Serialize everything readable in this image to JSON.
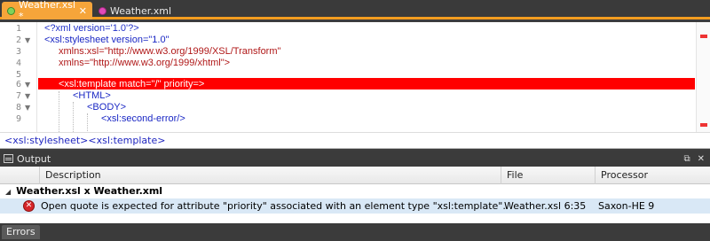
{
  "tabs": [
    {
      "label": "Weather.xsl *",
      "active": true
    },
    {
      "label": "Weather.xml",
      "active": false
    }
  ],
  "editor": {
    "line_numbers": [
      "1",
      "2",
      "3",
      "4",
      "5",
      "6",
      "7",
      "8",
      "9"
    ],
    "lines": {
      "l1": "<?xml version='1.0'?>",
      "l2": "<xsl:stylesheet version=\"1.0\"",
      "l3": "xmlns:xsl=\"http://www.w3.org/1999/XSL/Transform\"",
      "l4": "xmlns=\"http://www.w3.org/1999/xhtml\">",
      "l6": "<xsl:template match=\"/\" priority=>",
      "l7": "<HTML>",
      "l8": "<BODY>",
      "l9": "<xsl:second-error/>"
    }
  },
  "breadcrumb": {
    "item1": "<xsl:stylesheet>",
    "item2": "<xsl:template>"
  },
  "output": {
    "title": "Output",
    "columns": {
      "description": "Description",
      "file": "File",
      "processor": "Processor"
    },
    "group": "Weather.xsl x Weather.xml",
    "errors": [
      {
        "description": "Open quote is expected for attribute \"priority\" associated with an element type \"xsl:template\".",
        "file": "Weather.xsl 6:35",
        "processor": "Saxon-HE 9"
      }
    ]
  },
  "bottom_tabs": [
    "Errors"
  ],
  "colors": {
    "accent": "#f39c1f",
    "error_line": "#ff0000",
    "selected_row": "#d9e8f6"
  }
}
